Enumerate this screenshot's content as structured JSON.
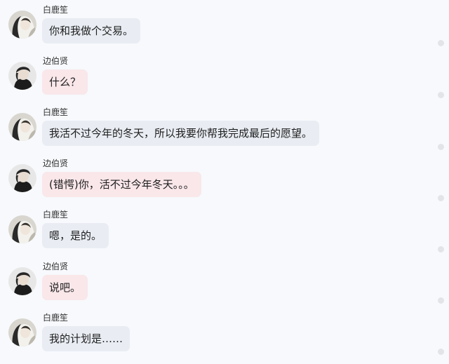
{
  "colors": {
    "background": "#f7f9fc",
    "bubble_a": "#e9edf3",
    "bubble_b": "#f9e7ea"
  },
  "messages": [
    {
      "sender": "白鹿笙",
      "text": "你和我做个交易。",
      "avatar": "girl-avatar-icon"
    },
    {
      "sender": "边伯贤",
      "text": "什么？",
      "avatar": "boy-avatar-icon"
    },
    {
      "sender": "白鹿笙",
      "text": "我活不过今年的冬天，所以我要你帮我完成最后的愿望。",
      "avatar": "girl-avatar-icon"
    },
    {
      "sender": "边伯贤",
      "text": "(错愕)你，活不过今年冬天。。。",
      "avatar": "boy-avatar-icon"
    },
    {
      "sender": "白鹿笙",
      "text": "嗯，是的。",
      "avatar": "girl-avatar-icon"
    },
    {
      "sender": "边伯贤",
      "text": "说吧。",
      "avatar": "boy-avatar-icon"
    },
    {
      "sender": "白鹿笙",
      "text": "我的计划是……",
      "avatar": "girl-avatar-icon"
    }
  ]
}
